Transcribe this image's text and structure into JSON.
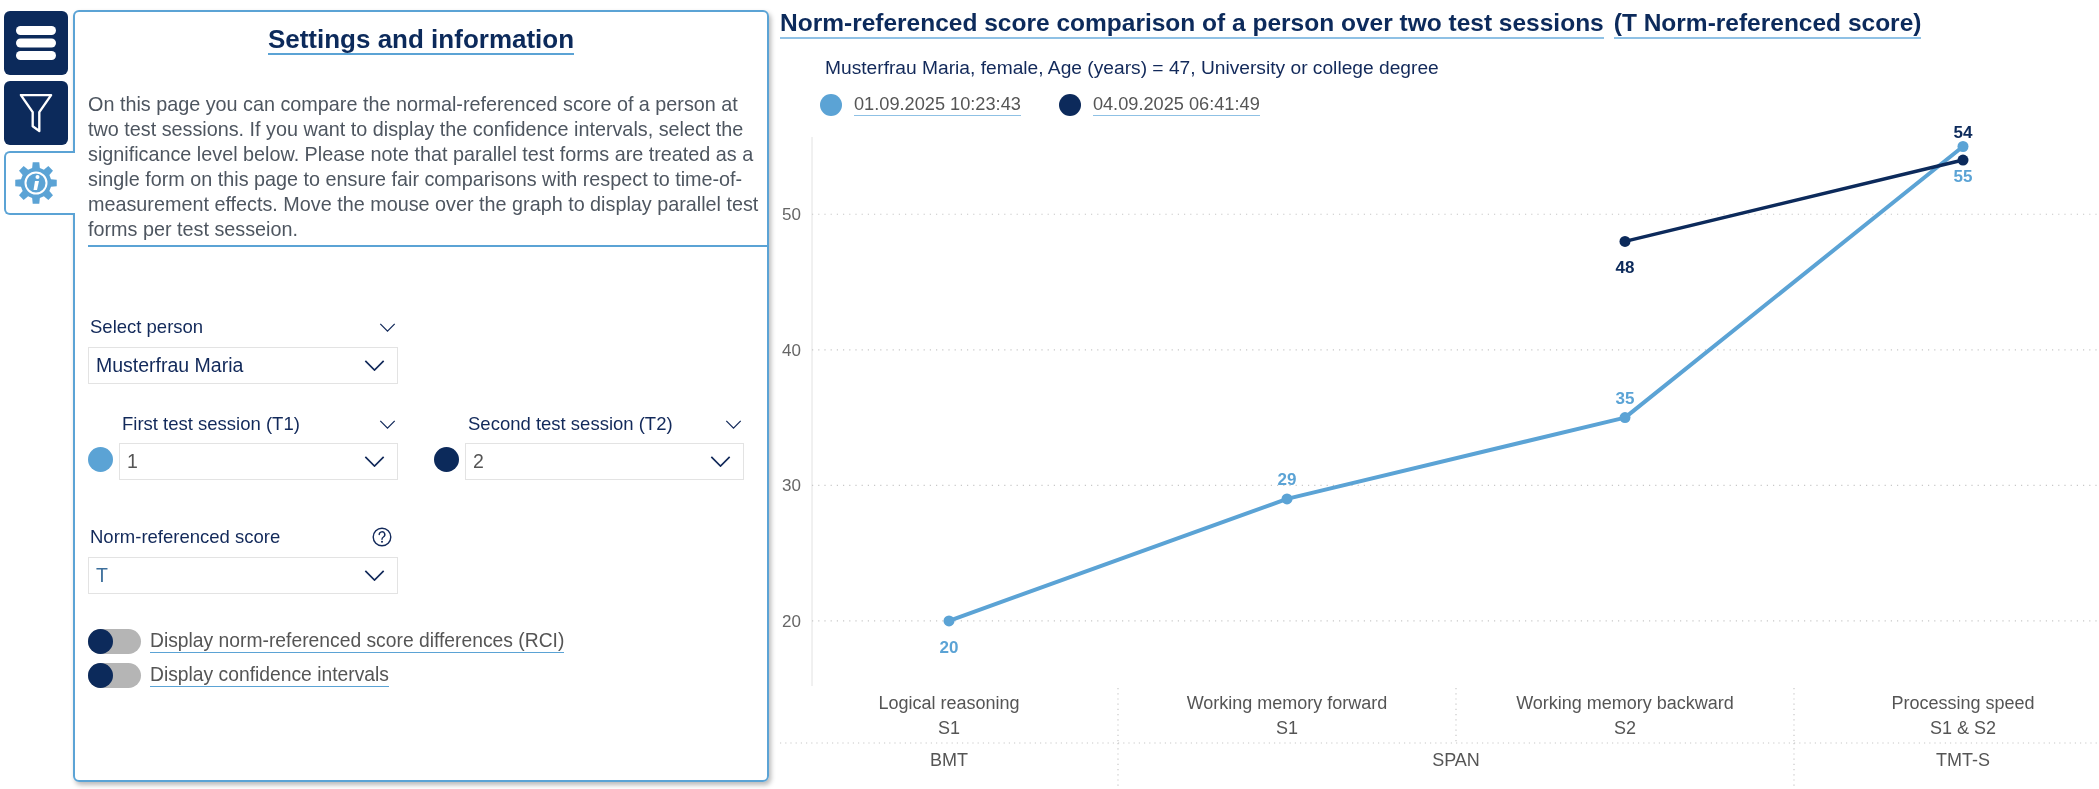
{
  "nav": [
    {
      "kind": "menu",
      "selected": false
    },
    {
      "kind": "filter",
      "selected": false
    },
    {
      "kind": "settings",
      "selected": true
    }
  ],
  "panel": {
    "title": "Settings and information",
    "description": "On this page you can compare the normal-referenced score of a person at two test sessions. If you want to display the confidence intervals, select the significance level below. Please note that parallel test forms are treated as a single form on this page to ensure fair comparisons with respect to time-of-measurement effects. Move the mouse over the graph to display parallel test forms per test sesseion.",
    "person": {
      "label": "Select person",
      "value": "Musterfrau Maria"
    },
    "sessions": [
      {
        "label": "First test session (T1)",
        "value": "1",
        "color": "#5ba3d5"
      },
      {
        "label": "Second test session (T2)",
        "value": "2",
        "color": "#0c2a5b"
      }
    ],
    "score": {
      "label": "Norm-referenced score",
      "value": "T"
    },
    "toggles": [
      {
        "label": "Display norm-referenced score differences (RCI)",
        "on": false
      },
      {
        "label": "Display confidence intervals",
        "on": false
      }
    ]
  },
  "chart": {
    "title": "Norm-referenced score comparison of a person over two test sessions",
    "title_note": "(T Norm-referenced score)",
    "subtitle": "Musterfrau Maria, female, Age (years) = 47, University or college degree",
    "axis_groups": [
      {
        "label": "BMT",
        "items": [
          {
            "subtest": "S1"
          }
        ]
      },
      {
        "label": "SPAN",
        "items": [
          {
            "subtest": "S1"
          },
          {
            "subtest": "S2"
          }
        ]
      },
      {
        "label": "TMT-S",
        "items": [
          {
            "subtest": "S1 & S2"
          }
        ]
      }
    ],
    "chart_data": {
      "type": "line",
      "categories": [
        "Logical reasoning",
        "Working memory forward",
        "Working memory backward",
        "Processing speed"
      ],
      "series": [
        {
          "name": "01.09.2025 10:23:43",
          "color": "#5ba3d5",
          "marker": "circle",
          "values": [
            20,
            29,
            35,
            55
          ]
        },
        {
          "name": "04.09.2025 06:41:49",
          "color": "#0c2a5b",
          "marker": "circle",
          "values": [
            null,
            null,
            48,
            54
          ]
        }
      ],
      "ylim": [
        15.2,
        55.7
      ],
      "yticks": [
        20,
        30,
        40,
        50
      ],
      "grid": true,
      "data_labels": true
    }
  }
}
